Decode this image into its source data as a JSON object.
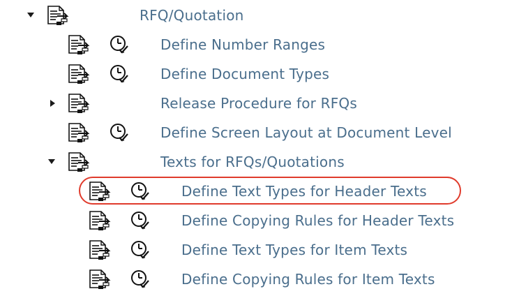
{
  "tree": {
    "items": [
      {
        "label": "RFQ/Quotation",
        "expander": "expanded",
        "has_clock": false
      },
      {
        "label": "Define Number Ranges",
        "expander": "none",
        "has_clock": true
      },
      {
        "label": "Define Document Types",
        "expander": "none",
        "has_clock": true
      },
      {
        "label": "Release Procedure for RFQs",
        "expander": "collapsed",
        "has_clock": false
      },
      {
        "label": "Define Screen Layout at Document Level",
        "expander": "none",
        "has_clock": true
      },
      {
        "label": "Texts for RFQs/Quotations",
        "expander": "expanded",
        "has_clock": false
      },
      {
        "label": "Define Text Types for Header Texts",
        "expander": "none",
        "has_clock": true,
        "highlighted": true
      },
      {
        "label": "Define Copying Rules for Header Texts",
        "expander": "none",
        "has_clock": true
      },
      {
        "label": "Define Text Types for Item Texts",
        "expander": "none",
        "has_clock": true
      },
      {
        "label": "Define Copying Rules for Item Texts",
        "expander": "none",
        "has_clock": true
      }
    ]
  },
  "icons": {
    "document": "document-execute-icon",
    "clock": "clock-check-icon",
    "expand": "triangle-down-icon",
    "collapse": "triangle-right-icon"
  },
  "colors": {
    "label": "#4a6e8c",
    "highlight_border": "#e03b2c"
  }
}
